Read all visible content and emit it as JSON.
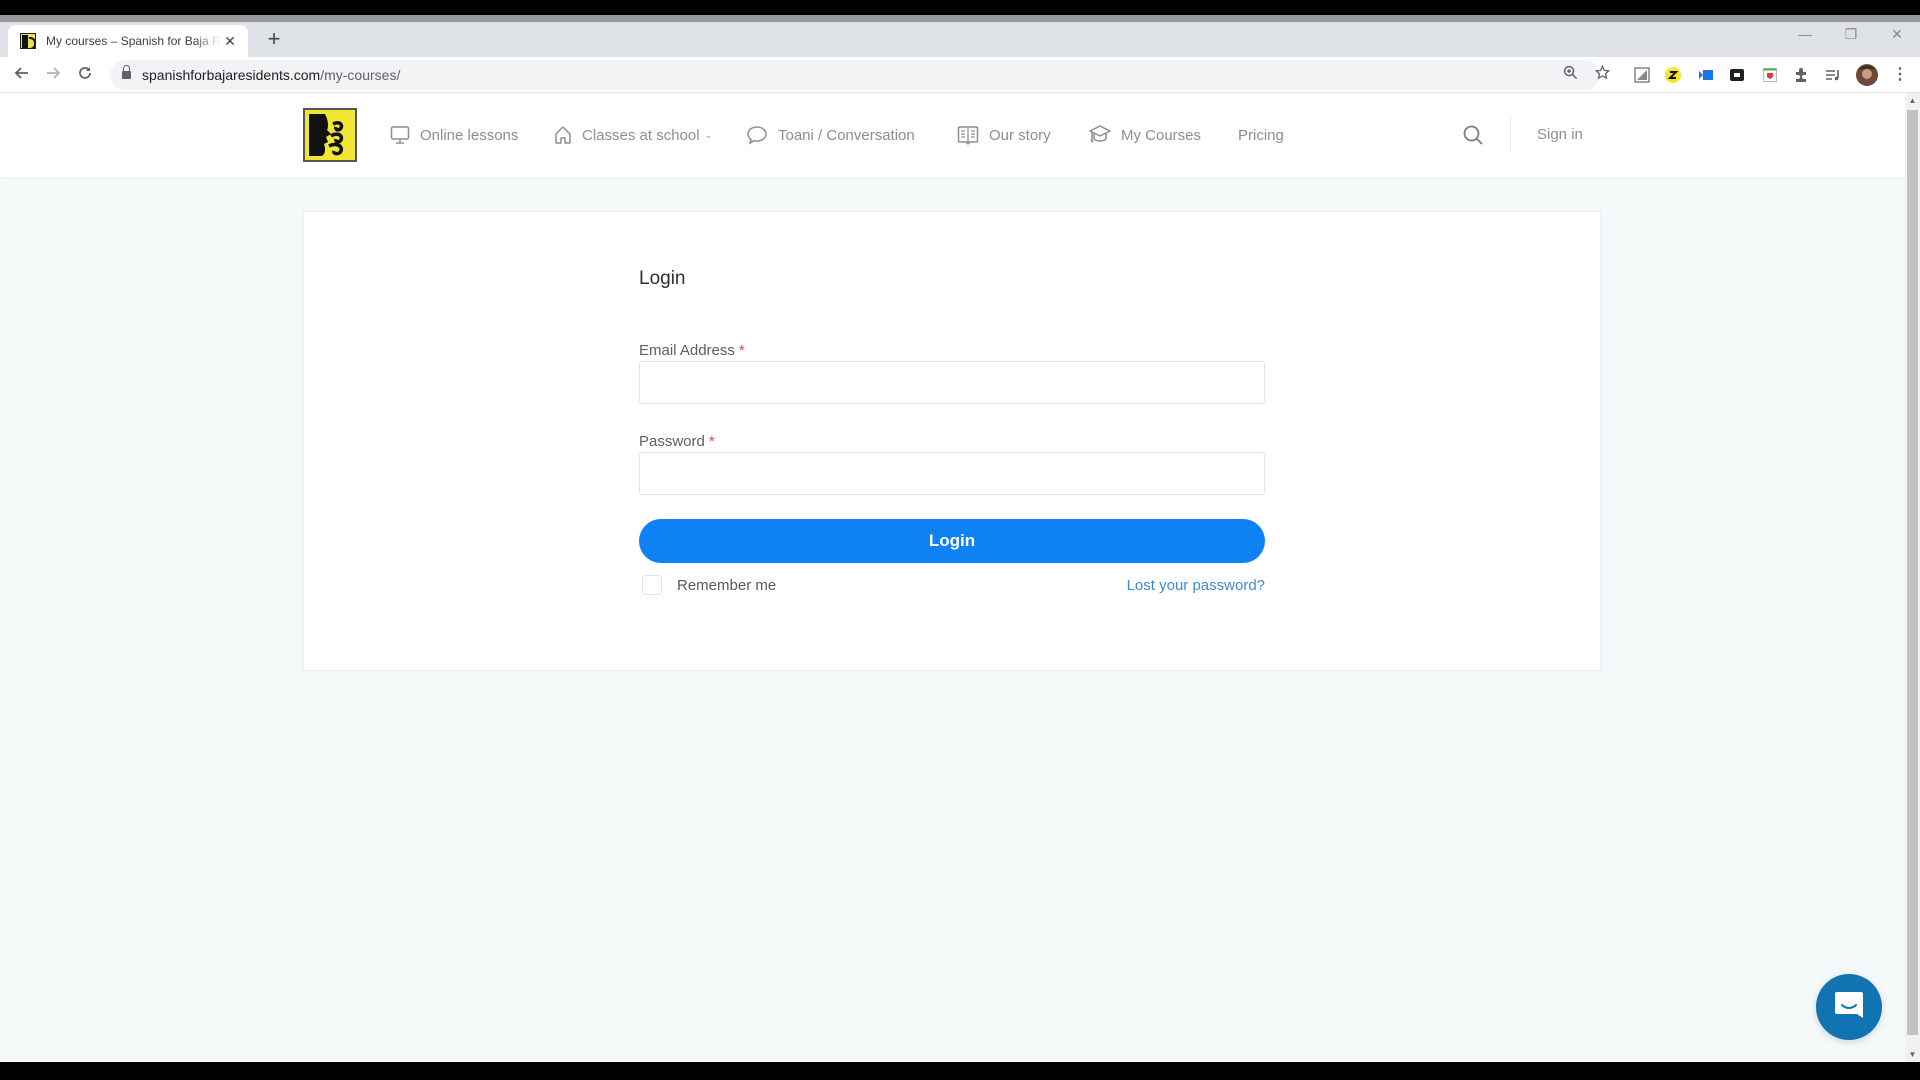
{
  "browser": {
    "tab": {
      "title": "My courses – Spanish for Baja Residents",
      "favicon": "site-logo-icon"
    },
    "new_tab_label": "+",
    "close_tab_label": "✕",
    "window_controls": {
      "minimize": "—",
      "restore": "❐",
      "close": "✕"
    },
    "address": {
      "domain": "spanishforbajaresidents.com",
      "path": "/my-courses/"
    },
    "toolbar_icons": [
      "zoom-icon",
      "bookmark-star-icon",
      "extension-icon",
      "z-extension-icon",
      "blue-extension-icon",
      "dark-extension-icon",
      "red-extension-icon",
      "puzzle-extensions-icon",
      "media-control-icon",
      "profile-avatar",
      "kebab-menu-icon"
    ]
  },
  "site": {
    "nav": [
      {
        "label": "Online lessons",
        "icon": "monitor-icon"
      },
      {
        "label": "Classes at school",
        "icon": "home-icon",
        "has_dropdown": true
      },
      {
        "label": "Toani / Conversation",
        "icon": "chat-bubble-icon"
      },
      {
        "label": "Our story",
        "icon": "book-icon"
      },
      {
        "label": "My Courses",
        "icon": "graduation-cap-icon"
      },
      {
        "label": "Pricing"
      }
    ],
    "sign_in_label": "Sign in",
    "search_icon": "search-icon"
  },
  "login": {
    "title": "Login",
    "email_label": "Email Address",
    "email_value": "",
    "password_label": "Password",
    "password_value": "",
    "required_marker": "*",
    "submit_label": "Login",
    "remember_label": "Remember me",
    "remember_checked": false,
    "lost_password_label": "Lost your password?"
  },
  "colors": {
    "primary_button": "#0e82f5",
    "link": "#3a8bd6",
    "required": "#d2475b",
    "chat_widget": "#1273b3",
    "page_background": "#f6f9fa"
  }
}
